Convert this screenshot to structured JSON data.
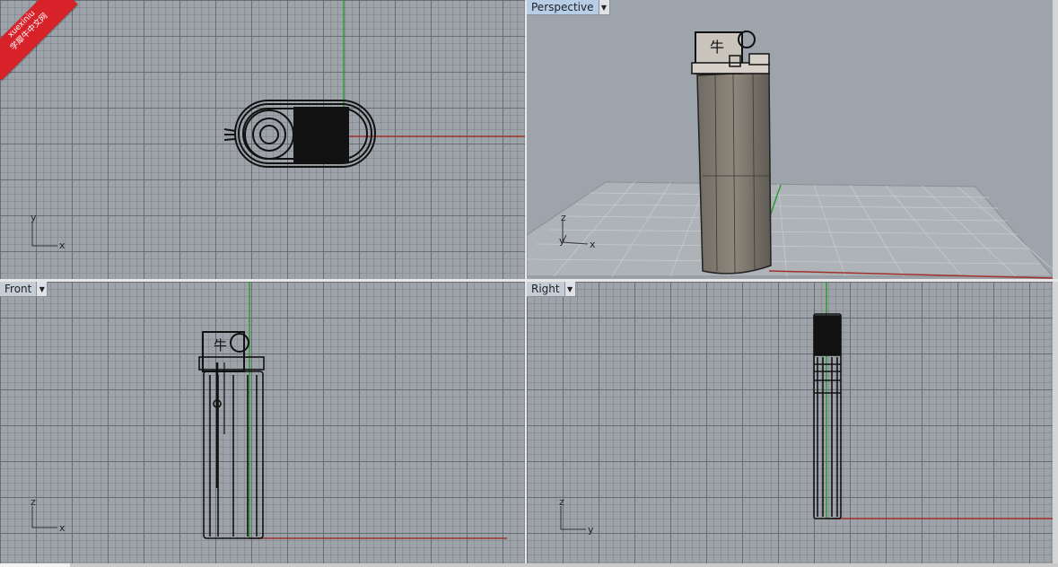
{
  "watermark": {
    "line1": "xuexiniu",
    "line2": "学犀牛中文网"
  },
  "viewports": {
    "top": {
      "axis_h": "x",
      "axis_v": "y"
    },
    "perspective": {
      "label": "Perspective",
      "axis_h": "x",
      "axis_v": "z"
    },
    "front": {
      "label": "Front",
      "axis_h": "x",
      "axis_v": "z"
    },
    "right": {
      "label": "Right",
      "axis_h": "y",
      "axis_v": "z"
    }
  },
  "colors": {
    "viewport_bg": "#9da3a9",
    "x_axis": "#a0322c",
    "y_axis": "#2f9a3a",
    "object": "#111111",
    "active_label": "#b8cde6"
  },
  "icons": {
    "dropdown": "triangle-down-icon"
  }
}
